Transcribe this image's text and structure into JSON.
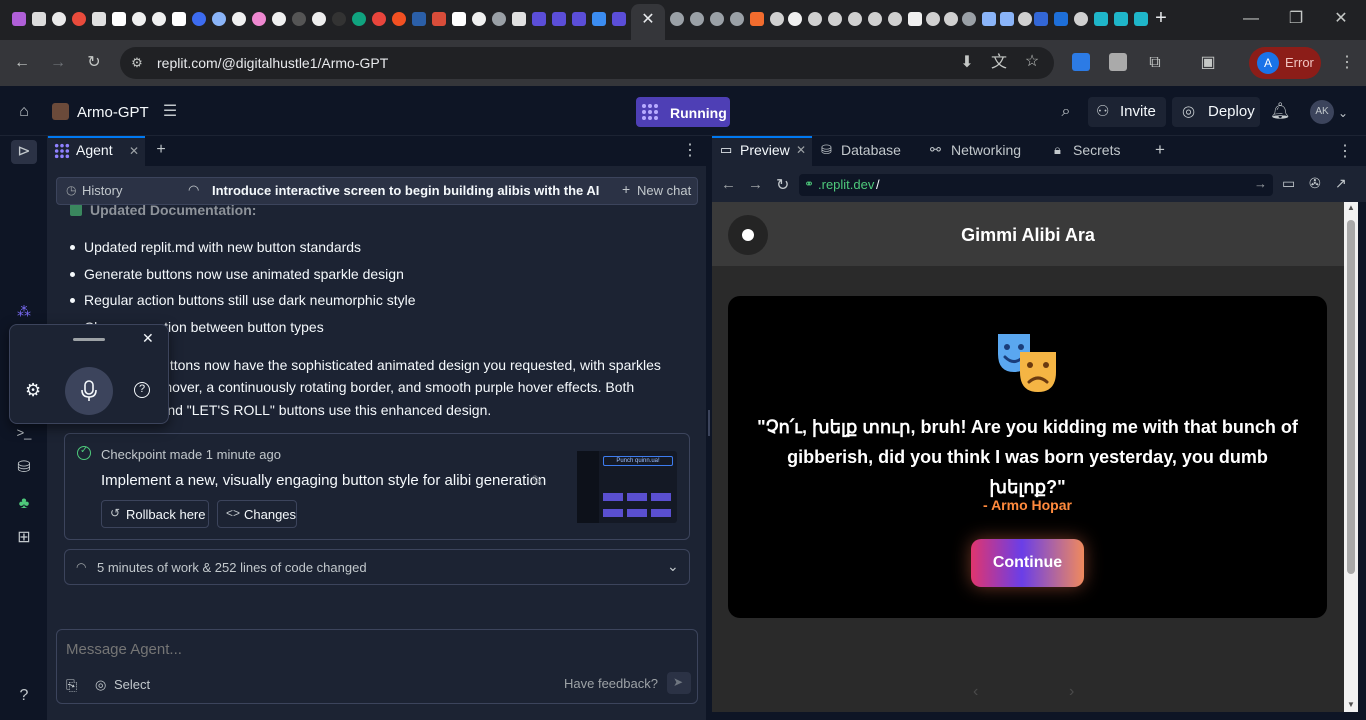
{
  "browser": {
    "url": "replit.com/@digitalhustle1/Armo-GPT",
    "profile_initial": "A",
    "profile_label": "Error",
    "new_tab": "+",
    "close_tab": "✕"
  },
  "header": {
    "app_name": "Armo-GPT",
    "running_label": "Running",
    "invite_label": "Invite",
    "deploy_label": "Deploy",
    "user_initials": "AK"
  },
  "agent": {
    "tab_label": "Agent",
    "history_label": "History",
    "chat_title": "Introduce interactive screen to begin building alibis with the AI",
    "new_chat_label": "New chat",
    "partial_heading": "Updated Documentation:",
    "bullets": [
      "Updated replit.md with new button standards",
      "Generate buttons now use animated sparkle design",
      "Regular action buttons still use dark neumorphic style",
      "Clear separation between button types"
    ],
    "paragraph_lines": [
      "The Generate buttons now have the sophisticated animated design you requested, with sparkles",
      "that animate on hover, a continuously rotating border, and smooth purple hover effects. Both",
      "the \"Generate\" and \"LET'S ROLL\" buttons use this enhanced design."
    ],
    "checkpoint_label": "Checkpoint made 1 minute ago",
    "checkpoint_desc": "Implement a new, visually engaging button style for alibi generation",
    "rollback_label": "Rollback here",
    "changes_label": "Changes",
    "work_summary": "5 minutes of work & 252 lines of code changed",
    "composer_placeholder": "Message Agent...",
    "select_label": "Select",
    "feedback_label": "Have feedback?",
    "thumb_title": "Punch quinn.ua!"
  },
  "preview": {
    "tabs": [
      "Preview",
      "Database",
      "Networking",
      "Secrets"
    ],
    "url_host": ".replit.dev",
    "url_path": "/",
    "site_title": "Gimmi Alibi Ara",
    "mask_emoji": "🎭",
    "quote_line1": "\"Չո՛ւ, խելք տուր, bruh! Are you kidding me with that bunch of",
    "quote_line2": "gibberish, did you think I was born yesterday, you dumb խելոք?\"",
    "author": "- Armo Hopar",
    "continue_label": "Continue"
  },
  "colors": {
    "accent": "#0079f2",
    "running": "#4e3fb5",
    "author": "#ff8a3d",
    "checkpoint_green": "#4ec97b"
  }
}
